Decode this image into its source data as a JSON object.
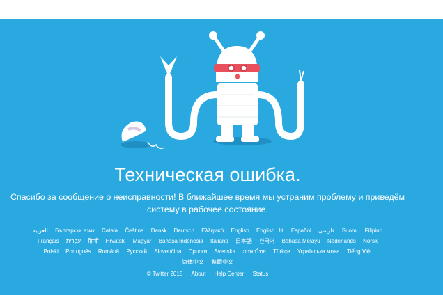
{
  "page": {
    "title": "Техническая ошибка.",
    "message_line1": "Спасибо за сообщение о неисправности! В ближайшее время мы устраним проблему и приведём",
    "message_line2": "систему в рабочее состояние."
  },
  "illustration": {
    "name": "broken-robot-illustration"
  },
  "languages": {
    "row1": [
      "العربية",
      "Български език",
      "Català",
      "Čeština",
      "Dansk",
      "Deutsch",
      "Ελληνικά",
      "English",
      "English UK",
      "Español",
      "فارسی",
      "Suomi",
      "Filipino"
    ],
    "row2": [
      "Français",
      "עִבְרִית",
      "हिन्दी",
      "Hrvatski",
      "Magyar",
      "Bahasa Indonesia",
      "Italiano",
      "日本語",
      "한국어",
      "Bahasa Melayu",
      "Nederlands",
      "Norsk"
    ],
    "row3": [
      "Polski",
      "Português",
      "Română",
      "Русский",
      "Slovenčina",
      "Српски",
      "Svenska",
      "ภาษาไทย",
      "Türkçe",
      "Українська мова",
      "Tiếng Việt"
    ],
    "row4": [
      "简体中文",
      "繁體中文"
    ]
  },
  "footer": {
    "copyright": "© Twitter 2018",
    "about": "About",
    "help": "Help Center",
    "status": "Status"
  },
  "colors": {
    "background": "#2aa9e0",
    "text": "#ffffff",
    "robot": "#ffffff",
    "visor": "#e8505b"
  }
}
